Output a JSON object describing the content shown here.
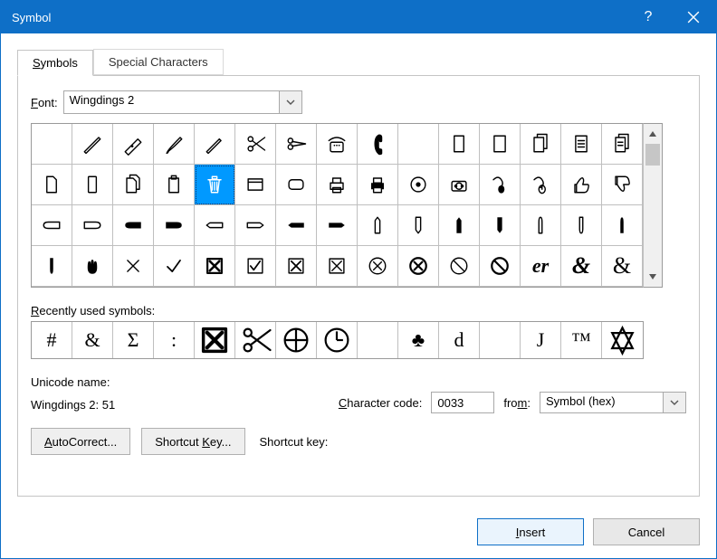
{
  "title": "Symbol",
  "tabs": {
    "symbols": "Symbols",
    "special": "Special Characters"
  },
  "font_label": "Font:",
  "font_value": "Wingdings 2",
  "main_grid_icons": [
    "blank",
    "pen",
    "fountain-pen",
    "brush-pen",
    "pencil",
    "scissors-open",
    "scissors-cut",
    "phone-desk",
    "handset",
    "blank",
    "page",
    "page-outline",
    "pages-stack",
    "page-lines",
    "pages-lines",
    "page-blank",
    "device-outline",
    "docs-stack",
    "clipboard",
    "trash",
    "window",
    "rounded-rect",
    "printer",
    "printer-filled",
    "disc",
    "camera",
    "mouse-cord",
    "mouse",
    "thumb-up",
    "thumb-down",
    "hand-left-outline",
    "hand-right-outline",
    "hand-left-fill",
    "hand-right-fill",
    "hand-left-out2",
    "hand-right-out2",
    "hand-point-left",
    "hand-point-right",
    "hand-up-outline",
    "hand-down-outline",
    "hand-up-fill",
    "hand-down-fill",
    "hand-up-out2",
    "hand-down-out2",
    "hand-point-up",
    "hand-point-down",
    "hand-open",
    "x-thin",
    "check",
    "x-box-bold",
    "check-box",
    "x-box",
    "x-box-thin",
    "circle-x",
    "circle-x-bold",
    "no-entry",
    "no-entry-bold",
    "er-script",
    "ampersand-script",
    "ampersand-outline"
  ],
  "selected_index": 19,
  "recent_label": "Recently used symbols:",
  "recent": [
    "#",
    "&",
    "Σ",
    ":",
    "⊠",
    "✂",
    "⊕",
    "◷",
    "",
    "♣",
    "d",
    "",
    "J",
    "™",
    "✡"
  ],
  "unicode_name_label": "Unicode name:",
  "unicode_name_value": "Wingdings 2: 51",
  "char_code_label": "Character code:",
  "char_code_value": "0033",
  "from_label": "from:",
  "from_value": "Symbol (hex)",
  "btn_autocorrect": "AutoCorrect...",
  "btn_shortcut": "Shortcut Key...",
  "shortcut_key_label": "Shortcut key:",
  "btn_insert": "Insert",
  "btn_cancel": "Cancel"
}
